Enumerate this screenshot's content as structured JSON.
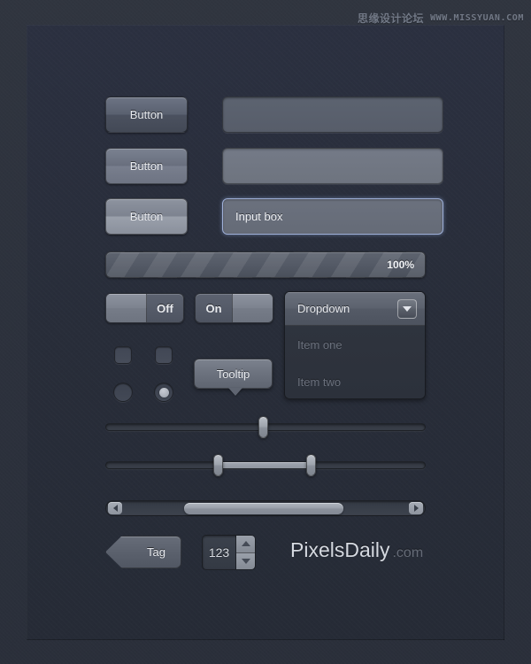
{
  "watermark": {
    "chinese": "思缘设计论坛",
    "english": "WWW.MISSYUAN.COM"
  },
  "buttons": [
    {
      "label": "Button",
      "state": "normal"
    },
    {
      "label": "Button",
      "state": "hover"
    },
    {
      "label": "Button",
      "state": "active"
    }
  ],
  "fields": [
    {
      "value": "",
      "placeholder": "",
      "state": "normal"
    },
    {
      "value": "",
      "placeholder": "",
      "state": "hover"
    },
    {
      "value": "Input box",
      "placeholder": "Input box",
      "state": "focused"
    }
  ],
  "progress": {
    "label": "100%",
    "percent": 100
  },
  "toggles": [
    {
      "label": "Off",
      "value": "off",
      "knob_side": "left"
    },
    {
      "label": "On",
      "value": "on",
      "knob_side": "right"
    }
  ],
  "dropdown": {
    "label": "Dropdown",
    "caret_icon": "chevron-down-icon",
    "items": [
      {
        "label": "Item one"
      },
      {
        "label": "Item two"
      }
    ]
  },
  "checkboxes": [
    {
      "checked": false
    },
    {
      "checked": false
    }
  ],
  "radios": [
    {
      "checked": false
    },
    {
      "checked": true
    }
  ],
  "tooltip": {
    "label": "Tooltip"
  },
  "sliders": [
    {
      "type": "single",
      "value": 49
    },
    {
      "type": "range",
      "low": 35,
      "high": 64
    }
  ],
  "scrollbar": {
    "left_arrow_icon": "triangle-left-icon",
    "right_arrow_icon": "triangle-right-icon",
    "thumb_start_percent": 24,
    "thumb_width_percent": 50
  },
  "tag": {
    "label": "Tag"
  },
  "stepper": {
    "value": "123",
    "up_icon": "triangle-up-icon",
    "down_icon": "triangle-down-icon"
  },
  "logo": {
    "name": "PixelsDaily",
    "tld": ".com"
  },
  "colors": {
    "background": "#2e333f",
    "panel": "#2a2f3a",
    "text": "#e8eaee",
    "muted_text": "#6a707c",
    "control_light": "#8d939f",
    "focus_ring": "#9fb0d8"
  }
}
